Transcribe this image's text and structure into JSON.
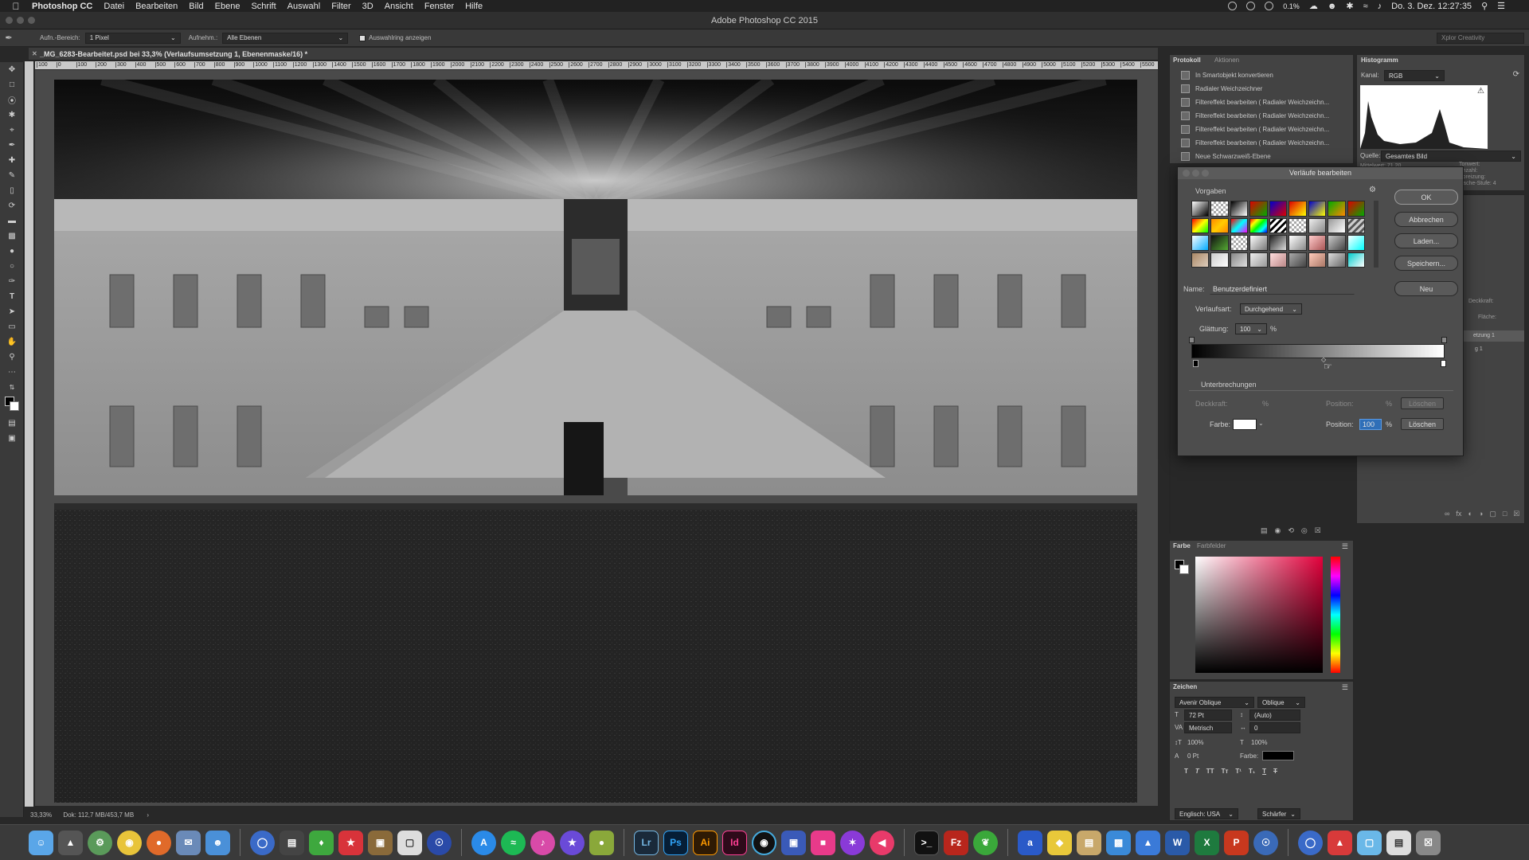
{
  "menubar": {
    "app_name": "Photoshop CC",
    "items": [
      "Datei",
      "Bearbeiten",
      "Bild",
      "Ebene",
      "Schrift",
      "Auswahl",
      "Filter",
      "3D",
      "Ansicht",
      "Fenster",
      "Hilfe"
    ],
    "battery": "0.1%",
    "datetime": "Do. 3. Dez. 12:27:35"
  },
  "window": {
    "title": "Adobe Photoshop CC 2015"
  },
  "options": {
    "area_label": "Aufn.-Bereich:",
    "area_value": "1 Pixel",
    "sample_label": "Aufnehm.:",
    "sample_value": "Alle Ebenen",
    "ring_label": "Auswahlring anzeigen",
    "right_label": "Xplor Creativity"
  },
  "document": {
    "tab_title": "_MG_6283-Bearbeitet.psd bei 33,3% (Verlaufsumsetzung 1, Ebenenmaske/16) *",
    "zoom": "33,33%",
    "doc_info": "Dok: 112,7 MB/453,7 MB"
  },
  "ruler_ticks": [
    "100",
    "0",
    "100",
    "200",
    "300",
    "400",
    "500",
    "600",
    "700",
    "800",
    "900",
    "1000",
    "1100",
    "1200",
    "1300",
    "1400",
    "1500",
    "1600",
    "1700",
    "1800",
    "1900",
    "2000",
    "2100",
    "2200",
    "2300",
    "2400",
    "2500",
    "2600",
    "2700",
    "2800",
    "2900",
    "3000",
    "3100",
    "3200",
    "3300",
    "3400",
    "3500",
    "3600",
    "3700",
    "3800",
    "3900",
    "4000",
    "4100",
    "4200",
    "4300",
    "4400",
    "4500",
    "4600",
    "4700",
    "4800",
    "4900",
    "5000",
    "5100",
    "5200",
    "5300",
    "5400",
    "5500"
  ],
  "protocol": {
    "tabs": [
      "Protokoll",
      "Aktionen"
    ],
    "items": [
      "In Smartobjekt konvertieren",
      "Radialer Weichzeichner",
      "Filtereffekt bearbeiten ( Radialer Weichzeichn...",
      "Filtereffekt bearbeiten ( Radialer Weichzeichn...",
      "Filtereffekt bearbeiten ( Radialer Weichzeichn...",
      "Filtereffekt bearbeiten ( Radialer Weichzeichn...",
      "Neue Schwarzweiß-Ebene"
    ]
  },
  "histogram": {
    "title": "Histogramm",
    "channel_label": "Kanal:",
    "channel_value": "RGB",
    "source_label": "Quelle:",
    "source_value": "Gesamtes Bild",
    "stats_left": [
      "Mittelwert: 71,20"
    ],
    "stats_right": [
      "Tonwert:",
      "Anzahl:",
      "Spreizung:",
      "Cache-Stufe: 4"
    ]
  },
  "gradient_dialog": {
    "title": "Verläufe bearbeiten",
    "presets_label": "Vorgaben",
    "buttons": {
      "ok": "OK",
      "cancel": "Abbrechen",
      "load": "Laden...",
      "save": "Speichern...",
      "new": "Neu"
    },
    "name_label": "Name:",
    "name_value": "Benutzerdefiniert",
    "type_label": "Verlaufsart:",
    "type_value": "Durchgehend",
    "smooth_label": "Glättung:",
    "smooth_value": "100",
    "percent": "%",
    "stops_label": "Unterbrechungen",
    "opacity_label": "Deckkraft:",
    "position_label": "Position:",
    "delete_label": "Löschen",
    "color_label": "Farbe:",
    "position_value": "100"
  },
  "layers_partial": {
    "texts": [
      "Deckkraft:",
      "Fläche:",
      "etzung 1",
      "g 1"
    ]
  },
  "color_panel": {
    "tabs": [
      "Farbe",
      "Farbfelder"
    ]
  },
  "char_panel": {
    "title": "Zeichen",
    "font": "Avenir Oblique",
    "style": "Oblique",
    "size": "72 Pt",
    "leading": "(Auto)",
    "kerning": "Metrisch",
    "tracking": "0",
    "vscale": "100%",
    "hscale": "100%",
    "baseline": "0 Pt",
    "color_label": "Farbe:",
    "lang": "Englisch: USA",
    "aa": "Schärfer"
  },
  "dock_apps": [
    "Lr",
    "Ps",
    "Ai",
    "Id",
    "Fz",
    "W",
    "X",
    "P",
    "a"
  ],
  "colors": {
    "ps_blue": "#2fa3f7",
    "lr_blue": "#74b6e2",
    "ai_orange": "#ff9a00",
    "id_pink": "#ff3f94"
  }
}
